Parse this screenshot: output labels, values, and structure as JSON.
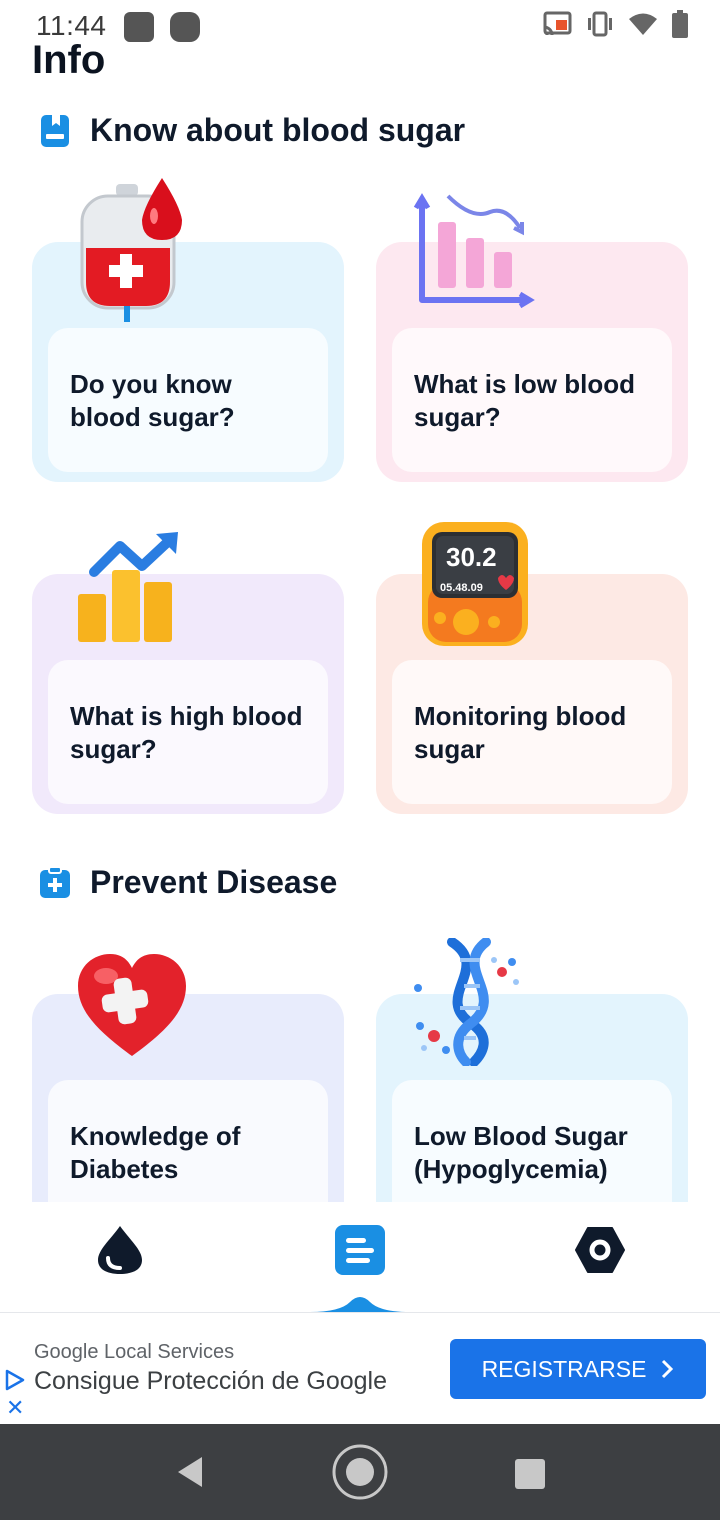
{
  "status_bar": {
    "time": "11:44",
    "icons": [
      "notification-icon",
      "notification-icon",
      "cast-icon",
      "vibrate-icon",
      "wifi-icon",
      "battery-icon"
    ]
  },
  "page": {
    "title": "Info"
  },
  "sections": [
    {
      "title": "Know about blood sugar",
      "icon": "book-icon",
      "cards": [
        {
          "label": "Do you know blood sugar?",
          "icon": "blood-bag-icon",
          "bg": "#e3f4fd"
        },
        {
          "label": "What is low blood sugar?",
          "icon": "bar-chart-down-icon",
          "bg": "#fde8f0"
        },
        {
          "label": "What is high blood sugar?",
          "icon": "bar-chart-up-icon",
          "bg": "#f1e9fb"
        },
        {
          "label": "Monitoring blood sugar",
          "icon": "glucometer-icon",
          "bg": "#fde9e4",
          "device_reading": "30.2",
          "device_time": "05.48.09"
        }
      ]
    },
    {
      "title": "Prevent Disease",
      "icon": "medical-clipboard-icon",
      "cards": [
        {
          "label": "Knowledge of Diabetes",
          "icon": "heart-cross-icon",
          "bg": "#e8ecfc"
        },
        {
          "label": "Low Blood Sugar (Hypoglycemia)",
          "icon": "dna-icon",
          "bg": "#e3f4fd"
        }
      ]
    }
  ],
  "bottom_nav": {
    "items": [
      "drop-icon",
      "info-list-icon",
      "settings-icon"
    ],
    "active_index": 1
  },
  "ad": {
    "sponsor": "Google Local Services",
    "headline": "Consigue Protección de Google",
    "cta": "REGISTRARSE"
  },
  "colors": {
    "accent": "#1a8fe3",
    "ad_button": "#1a73e8",
    "nav_dark": "#0f1a2b",
    "system_nav_bg": "#3d3f42"
  }
}
